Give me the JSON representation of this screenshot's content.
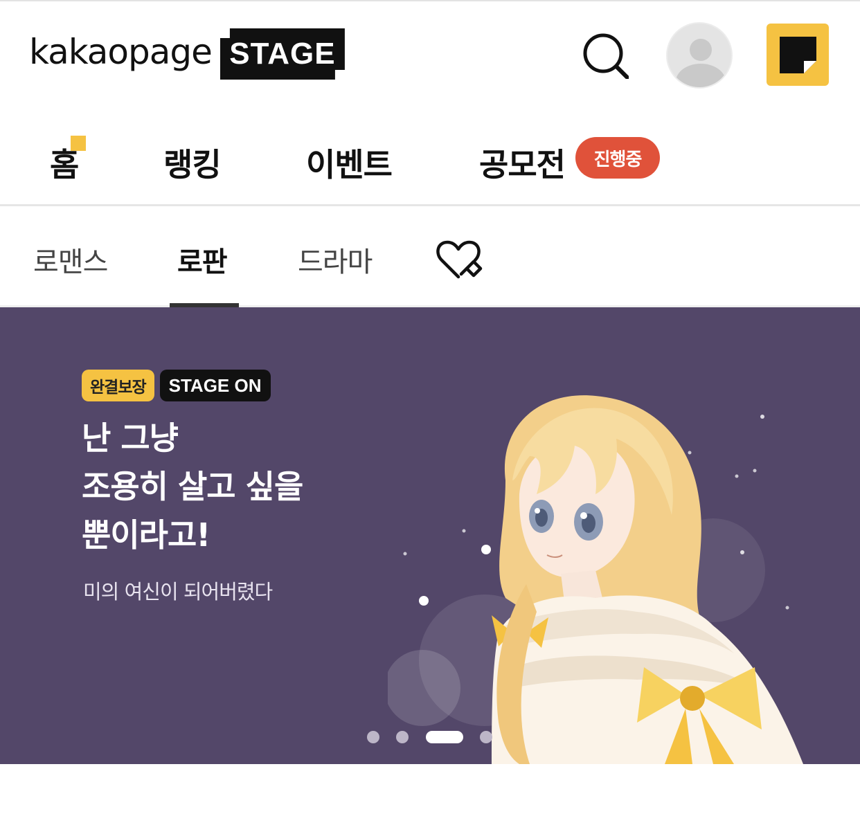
{
  "header": {
    "logo_word": "kakaopage",
    "logo_stage": "STAGE"
  },
  "main_nav": {
    "items": [
      {
        "label": "홈"
      },
      {
        "label": "랭킹"
      },
      {
        "label": "이벤트"
      },
      {
        "label": "공모전"
      }
    ],
    "contest_badge": "진행중"
  },
  "genre_tabs": {
    "items": [
      {
        "label": "로맨스"
      },
      {
        "label": "로판",
        "selected": true
      },
      {
        "label": "드라마"
      }
    ],
    "favorites_icon": "heart-pin-icon"
  },
  "banner": {
    "badge_guarantee": "완결보장",
    "badge_stage_on": "STAGE ON",
    "title_lines": [
      "난 그냥",
      "조용히 살고 싶을",
      "뿐이라고!"
    ],
    "subtitle": "미의 여신이 되어버렸다",
    "carousel_count": 4,
    "carousel_active_index": 2
  },
  "colors": {
    "accent_yellow": "#f5c242",
    "badge_red": "#e0523a",
    "banner_bg": "#534769"
  }
}
